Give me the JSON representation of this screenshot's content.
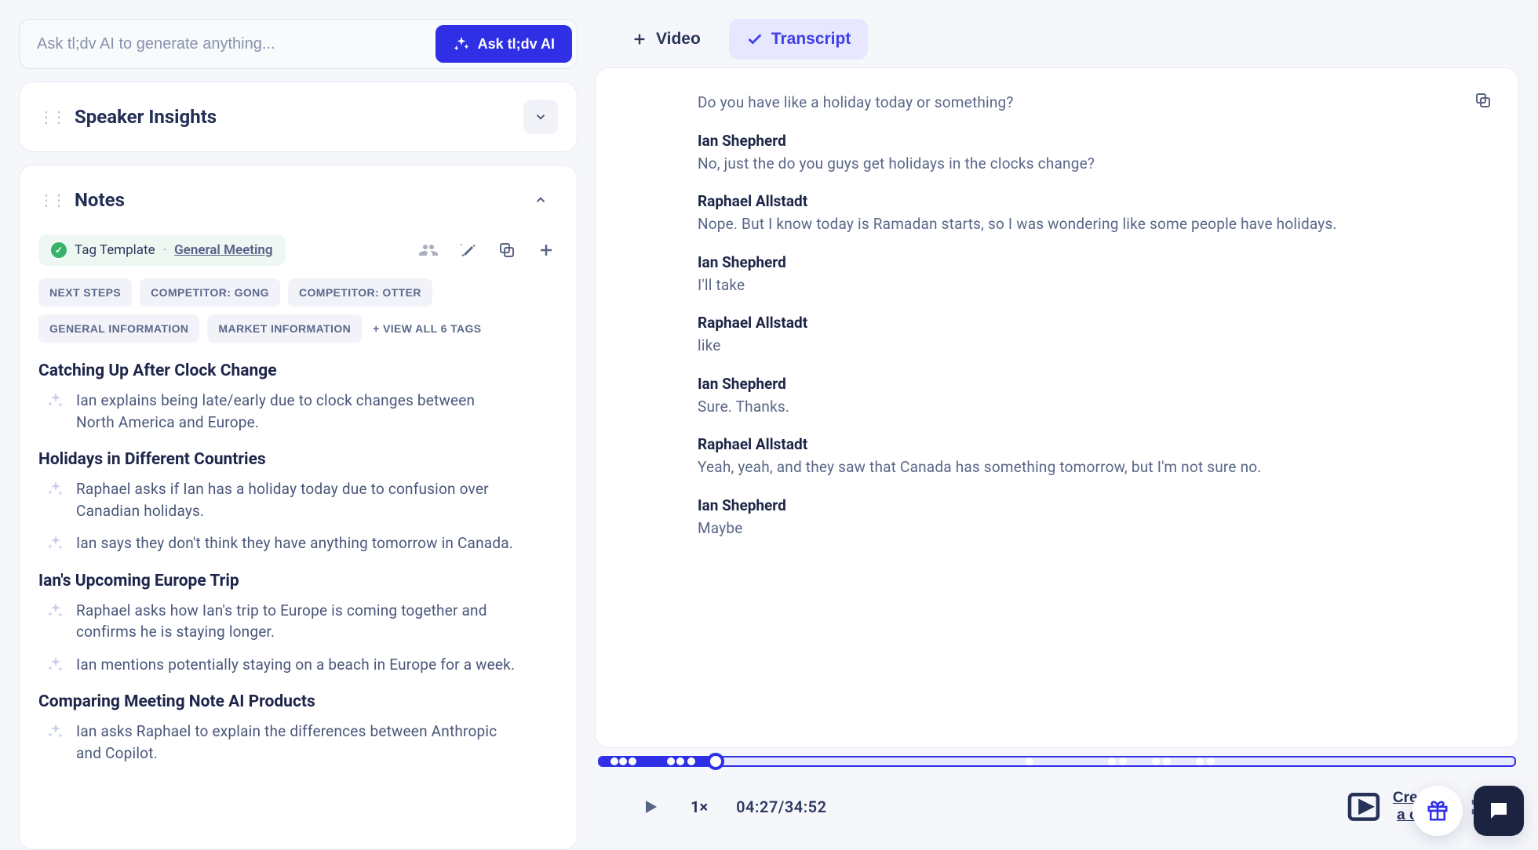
{
  "ask": {
    "placeholder": "Ask tl;dv AI to generate anything...",
    "button_label": "Ask tl;dv AI"
  },
  "speaker_panel": {
    "title": "Speaker Insights"
  },
  "notes_panel": {
    "title": "Notes",
    "template_label": "Tag Template",
    "template_link": "General Meeting",
    "tags": [
      "NEXT STEPS",
      "COMPETITOR: GONG",
      "COMPETITOR: OTTER",
      "GENERAL INFORMATION",
      "MARKET INFORMATION"
    ],
    "view_all_label": "+ VIEW ALL 6 TAGS",
    "sections": [
      {
        "title": "Catching Up After Clock Change",
        "bullets": [
          "Ian explains being late/early due to clock changes between North America and Europe."
        ]
      },
      {
        "title": "Holidays in Different Countries",
        "bullets": [
          "Raphael asks if Ian has a holiday today due to confusion over Canadian holidays.",
          "Ian says they don't think they have anything tomorrow in Canada."
        ]
      },
      {
        "title": "Ian's Upcoming Europe Trip",
        "bullets": [
          "Raphael asks how Ian's trip to Europe is coming together and confirms he is staying longer.",
          "Ian mentions potentially staying on a beach in Europe for a week."
        ]
      },
      {
        "title": "Comparing Meeting Note AI Products",
        "bullets": [
          "Ian asks Raphael to explain the differences between Anthropic and Copilot."
        ]
      }
    ]
  },
  "tabs": {
    "video": "Video",
    "transcript": "Transcript"
  },
  "transcript": {
    "lead": "Do you have like a holiday today or something?",
    "blocks": [
      {
        "speaker": "Ian Shepherd",
        "text": "No, just the do you guys get holidays in the clocks change?"
      },
      {
        "speaker": "Raphael Allstadt",
        "text": "Nope. But I know today is Ramadan starts, so I was wondering like some people have holidays."
      },
      {
        "speaker": "Ian Shepherd",
        "text": "I'll take"
      },
      {
        "speaker": "Raphael Allstadt",
        "text": "like"
      },
      {
        "speaker": "Ian Shepherd",
        "text": "Sure. Thanks."
      },
      {
        "speaker": "Raphael Allstadt",
        "text": "Yeah, yeah, and they saw that Canada has something tomorrow, but I'm not sure no."
      },
      {
        "speaker": "Ian Shepherd",
        "text": "Maybe"
      }
    ]
  },
  "timeline": {
    "progress_pct": 12.7,
    "markers_pct": [
      1.6,
      2.6,
      3.6,
      7.8,
      8.8,
      10.0,
      47.0,
      56.0,
      57.2,
      60.8,
      62.0,
      65.6,
      66.8
    ]
  },
  "player": {
    "speed": "1×",
    "time": "04:27/34:52",
    "clip_label": "Create a clip"
  }
}
